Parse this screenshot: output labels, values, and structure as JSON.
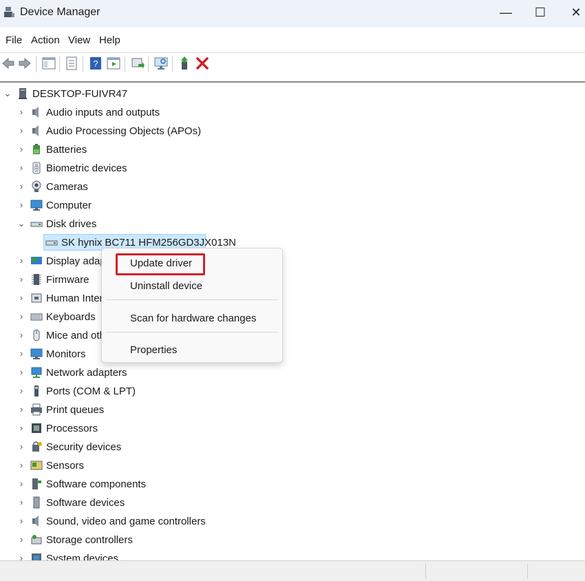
{
  "window": {
    "title": "Device Manager",
    "minimize_glyph": "—",
    "maximize_glyph": "☐",
    "close_glyph": "✕"
  },
  "menu": [
    "File",
    "Action",
    "View",
    "Help"
  ],
  "toolbar": {
    "icons": [
      "back-icon",
      "forward-icon",
      "show-hide-console-tree-icon",
      "properties-icon",
      "help-icon",
      "show-action-pane-icon",
      "update-driver-icon",
      "scan-hardware-icon",
      "enable-device-icon",
      "uninstall-device-icon"
    ]
  },
  "tree": {
    "root": "DESKTOP-FUIVR47",
    "categories": [
      {
        "label": "Audio inputs and outputs",
        "icon": "speaker-icon"
      },
      {
        "label": "Audio Processing Objects (APOs)",
        "icon": "speaker-icon"
      },
      {
        "label": "Batteries",
        "icon": "battery-icon"
      },
      {
        "label": "Biometric devices",
        "icon": "fingerprint-icon"
      },
      {
        "label": "Cameras",
        "icon": "camera-icon"
      },
      {
        "label": "Computer",
        "icon": "monitor-icon"
      },
      {
        "label": "Disk drives",
        "icon": "disk-drive-icon",
        "expanded": true
      },
      {
        "label": "Display adapt",
        "icon": "display-adapter-icon"
      },
      {
        "label": "Firmware",
        "icon": "chip-icon"
      },
      {
        "label": "Human Interfa",
        "icon": "hid-icon"
      },
      {
        "label": "Keyboards",
        "icon": "keyboard-icon"
      },
      {
        "label": "Mice and othe",
        "icon": "mouse-icon"
      },
      {
        "label": "Monitors",
        "icon": "monitor-icon"
      },
      {
        "label": "Network adapters",
        "icon": "network-icon"
      },
      {
        "label": "Ports (COM & LPT)",
        "icon": "port-icon"
      },
      {
        "label": "Print queues",
        "icon": "printer-icon"
      },
      {
        "label": "Processors",
        "icon": "processor-icon"
      },
      {
        "label": "Security devices",
        "icon": "security-icon"
      },
      {
        "label": "Sensors",
        "icon": "sensor-icon"
      },
      {
        "label": "Software components",
        "icon": "software-component-icon"
      },
      {
        "label": "Software devices",
        "icon": "software-device-icon"
      },
      {
        "label": "Sound, video and game controllers",
        "icon": "speaker-icon"
      },
      {
        "label": "Storage controllers",
        "icon": "storage-controller-icon"
      },
      {
        "label": "System devices",
        "icon": "system-devices-icon"
      }
    ],
    "disk_child": "SK hynix BC711 HFM256GD3JX013N"
  },
  "context_menu": {
    "items": [
      "Update driver",
      "Uninstall device",
      "Scan for hardware changes",
      "Properties"
    ],
    "highlighted": "Update driver",
    "highlight_color": "#d0222a"
  },
  "colors": {
    "selection_bg": "#cce8ff",
    "titlebar_bg": "#eef3fa"
  }
}
